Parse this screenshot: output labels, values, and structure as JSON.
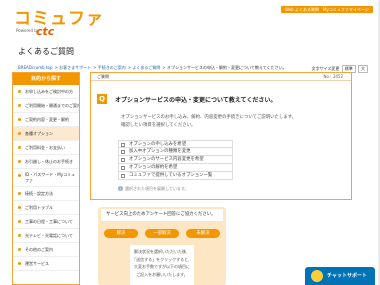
{
  "header": {
    "logo_text": "コミュファ",
    "logo_sub": "Powered by",
    "logo_brand": "ctc",
    "btn_online": "Web よくある質問",
    "btn_mypage": "Myコミュファマイページ"
  },
  "page_title": "よくあるご質問",
  "breadcrumb": [
    "BREADcrumb top",
    "お客さまサポート",
    "手続きのご案内",
    "よくあるご質問",
    "オプションサービスの申込・解約・変更について教えてください。"
  ],
  "font_size": {
    "label": "文字サイズ変更",
    "options": [
      "標準",
      "大"
    ]
  },
  "sidebar": {
    "heading": "目的から探す",
    "items": [
      "お申し込みをご検討中の方",
      "ご利用開始・開通までのご案内",
      "ご契約内容・変更・解約",
      "各種オプション",
      "ご利用料金・お支払い",
      "お引越し・休止のお手続き",
      "ID・パスワード・Myコミュファ",
      "接続・設定方法",
      "ご利用トラブル",
      "工事の日程・工事について",
      "光テレビ・光電話について",
      "その他のご案内",
      "運営サービス"
    ]
  },
  "faq": {
    "category": "ご質問",
    "question_no": "No : 3452",
    "question": "オプションサービスの申込・変更について教えてください。",
    "intro_1": "オプションサービスのお申し込み、解約、内容変更の手続きについてご説明いたします。",
    "intro_2": "確認したい項目を選択してください。",
    "options": [
      "オプションの申し込みを希望",
      "加入中オプションの種類を変更",
      "オプションのサービス内容変更を希望",
      "オプションの解約を希望",
      "コミュファで提供しているオプション一覧"
    ],
    "note": "選択された項目を展開しています。"
  },
  "survey": {
    "heading": "サービス向上のためアンケート回答にご協力ください。",
    "buttons": [
      "解決",
      "一部解決",
      "未解決"
    ],
    "card_lines": [
      "解決状況を選択いただいた後、",
      "「送信する」をクリックすると、",
      "大変お手数ですが以下の項目に",
      "ご記入をお願いいたします。"
    ]
  },
  "chatbot": {
    "label": "チャットサポート"
  },
  "colors": {
    "brand_orange": "#f39700",
    "chat_blue": "#0073b7"
  }
}
